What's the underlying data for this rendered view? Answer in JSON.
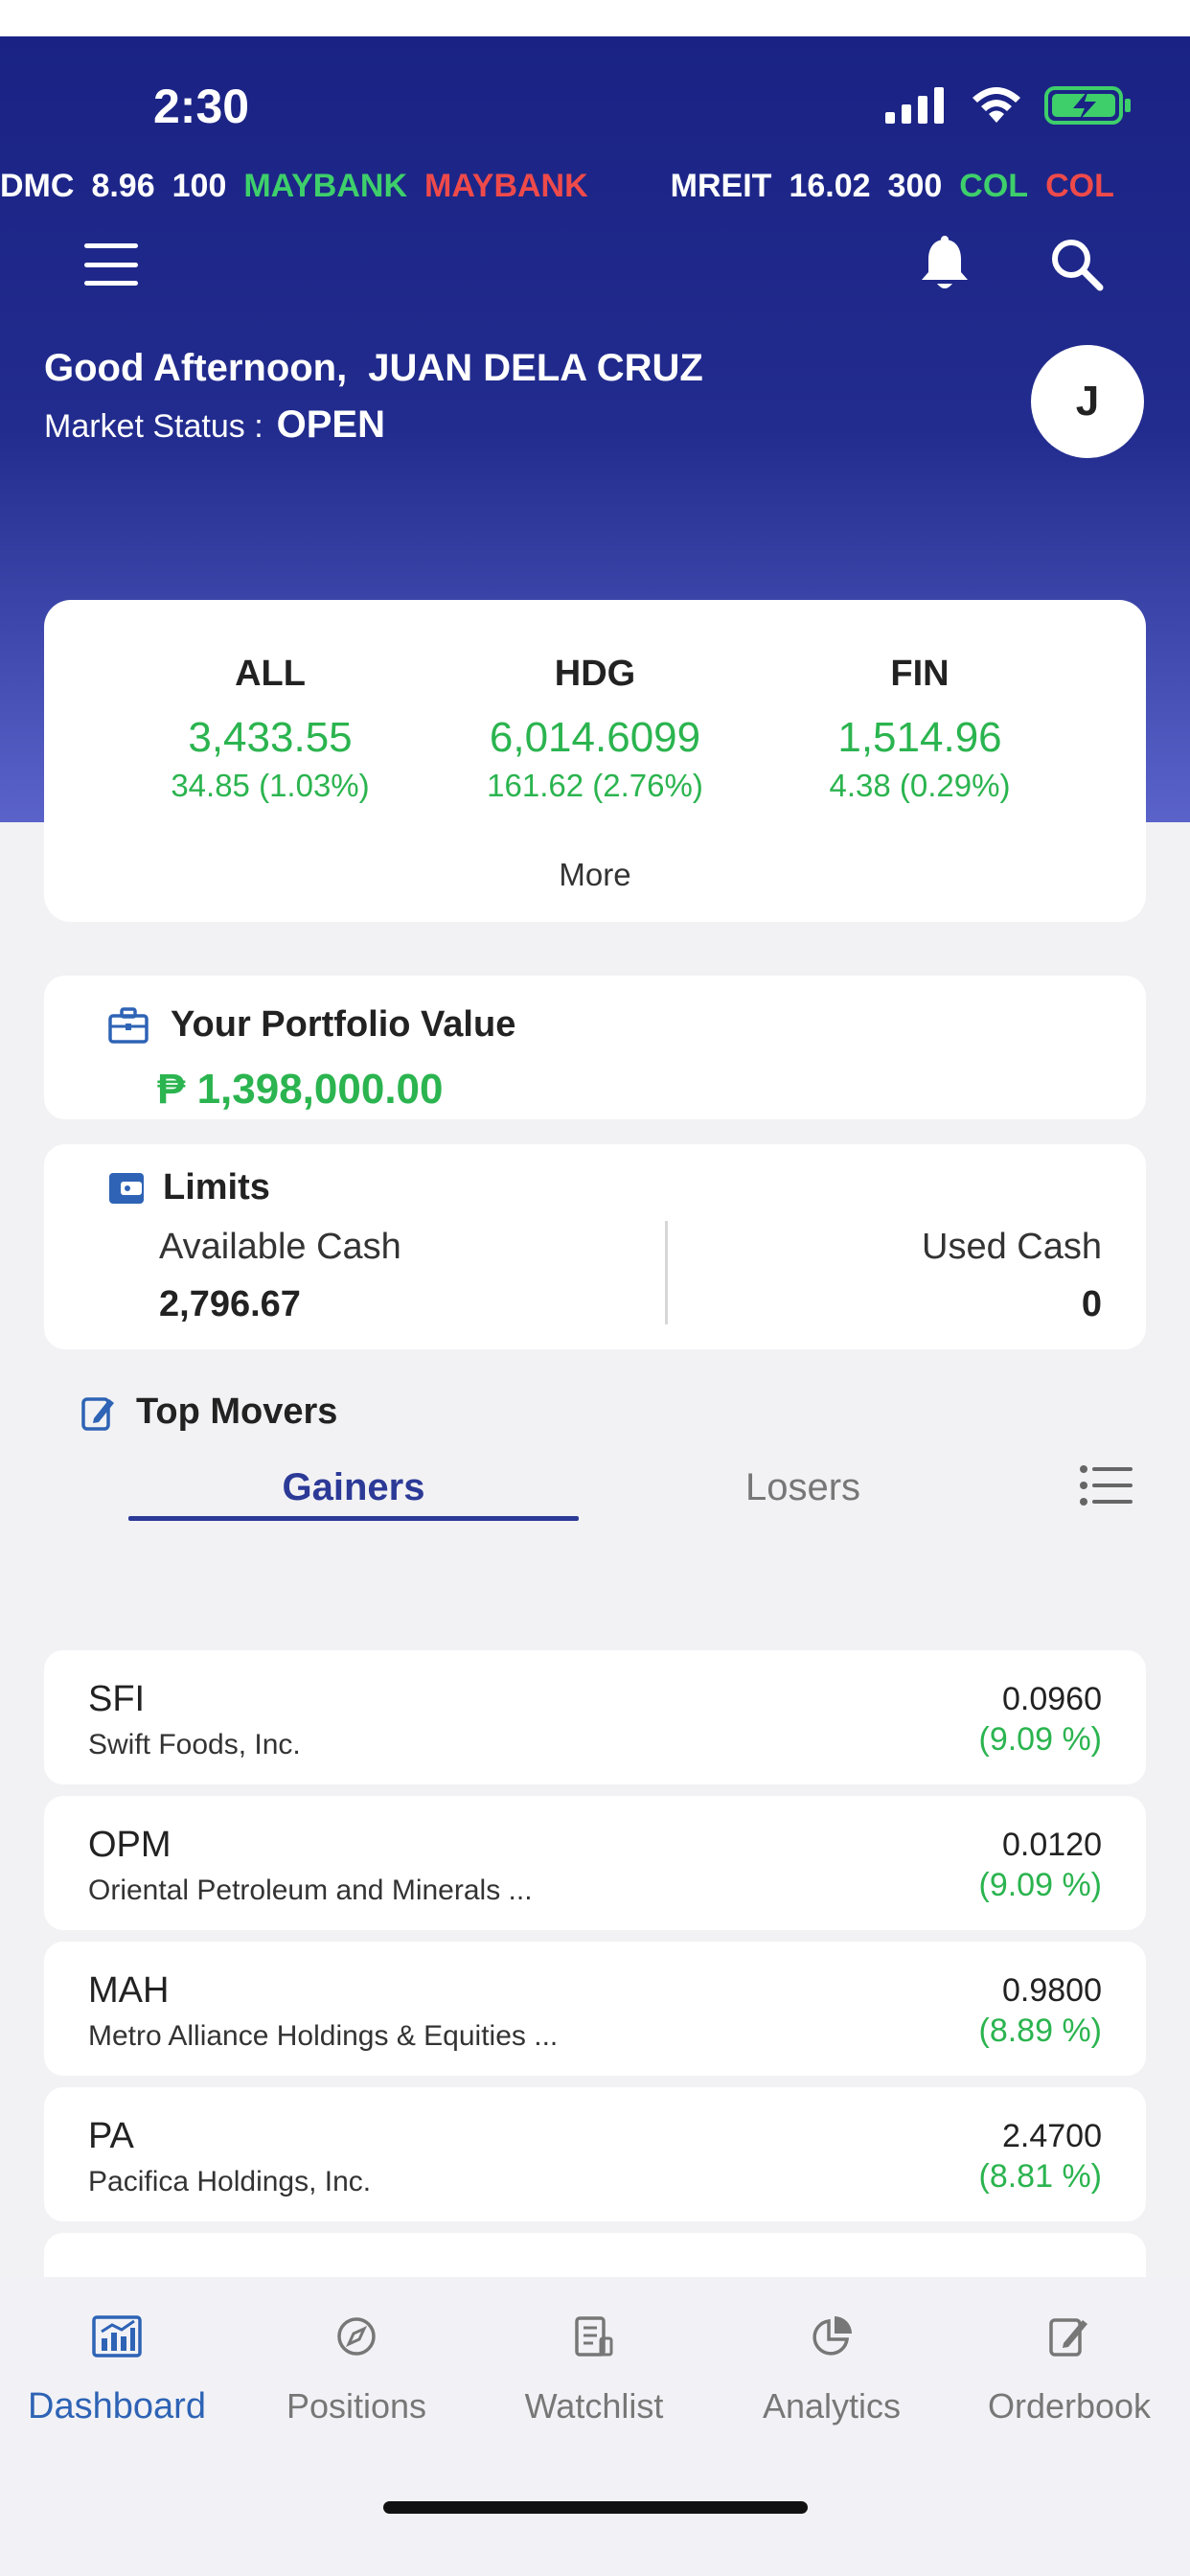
{
  "status_bar": {
    "time": "2:30"
  },
  "ticker": [
    {
      "symbol": "DMC",
      "price": "8.96",
      "volume": "100",
      "buyer": "MAYBANK",
      "seller": "MAYBANK"
    },
    {
      "symbol": "MREIT",
      "price": "16.02",
      "volume": "300",
      "buyer": "COL",
      "seller": "COL"
    }
  ],
  "colors": {
    "header": "#1a2384",
    "gain": "#2bb44f",
    "loss": "#ef4a4a",
    "accent": "#2c3a97",
    "nav_active": "#2e63b5"
  },
  "icons": {
    "menu": "hamburger-icon",
    "notifications": "bell-icon",
    "search": "search-icon"
  },
  "greeting": {
    "prefix": "Good Afternoon,",
    "name": "JUAN DELA CRUZ",
    "avatar_initial": "J"
  },
  "market_status": {
    "label": "Market Status :",
    "value": "OPEN"
  },
  "indices": [
    {
      "name": "ALL",
      "value": "3,433.55",
      "change": "34.85",
      "pct": "(1.03%)"
    },
    {
      "name": "HDG",
      "value": "6,014.6099",
      "change": "161.62",
      "pct": "(2.76%)"
    },
    {
      "name": "FIN",
      "value": "1,514.96",
      "change": "4.38",
      "pct": "(0.29%)"
    }
  ],
  "indices_more": "More",
  "portfolio": {
    "title": "Your Portfolio Value",
    "value": "₱ 1,398,000.00"
  },
  "limits": {
    "title": "Limits",
    "available_label": "Available Cash",
    "available_value": "2,796.67",
    "used_label": "Used Cash",
    "used_value": "0"
  },
  "top_movers": {
    "title": "Top Movers",
    "tabs": [
      "Gainers",
      "Losers"
    ],
    "active_tab": "Gainers",
    "rows": [
      {
        "symbol": "SFI",
        "name": "Swift Foods, Inc.",
        "price": "0.0960",
        "pct": "(9.09 %)"
      },
      {
        "symbol": "OPM",
        "name": "Oriental Petroleum and Minerals ...",
        "price": "0.0120",
        "pct": "(9.09 %)"
      },
      {
        "symbol": "MAH",
        "name": "Metro Alliance Holdings & Equities ...",
        "price": "0.9800",
        "pct": "(8.89 %)"
      },
      {
        "symbol": "PA",
        "name": "Pacifica Holdings, Inc.",
        "price": "2.4700",
        "pct": "(8.81 %)"
      }
    ]
  },
  "bottom_nav": [
    {
      "label": "Dashboard",
      "icon": "dashboard-icon",
      "active": true
    },
    {
      "label": "Positions",
      "icon": "compass-icon",
      "active": false
    },
    {
      "label": "Watchlist",
      "icon": "document-icon",
      "active": false
    },
    {
      "label": "Analytics",
      "icon": "pie-chart-icon",
      "active": false
    },
    {
      "label": "Orderbook",
      "icon": "edit-document-icon",
      "active": false
    }
  ]
}
